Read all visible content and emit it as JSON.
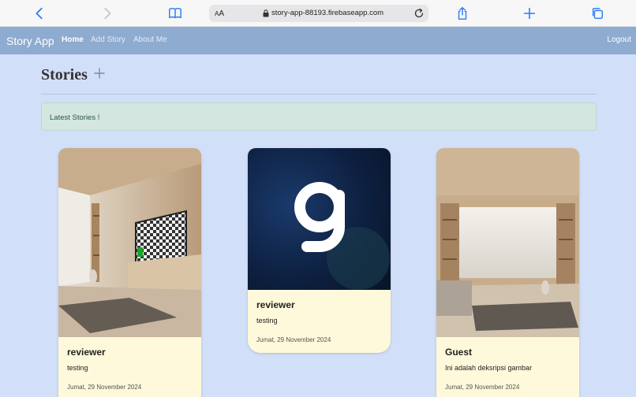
{
  "browser": {
    "url": "story-app-88193.firebaseapp.com",
    "text_size_label": "AA"
  },
  "navbar": {
    "brand": "Story App",
    "links": [
      {
        "label": "Home",
        "active": true
      },
      {
        "label": "Add Story",
        "active": false
      },
      {
        "label": "About Me",
        "active": false
      }
    ],
    "logout": "Logout"
  },
  "main": {
    "title": "Stories",
    "alert": "Latest Stories !"
  },
  "stories": [
    {
      "author": "reviewer",
      "description": "testing",
      "date": "Jumat, 29 November 2024",
      "image": "room-with-tv-image"
    },
    {
      "author": "reviewer",
      "description": "testing",
      "date": "Jumat, 29 November 2024",
      "image": "g-logo-image"
    },
    {
      "author": "Guest",
      "description": "Ini adalah deksripsi gambar",
      "date": "Jumat, 29 November 2024",
      "image": "room-with-sofa-image"
    }
  ],
  "colors": {
    "navbar": "#8eabd0",
    "page_background": "#d2dff8",
    "card_background": "#fef9da",
    "alert_background": "#d3e6e0"
  }
}
